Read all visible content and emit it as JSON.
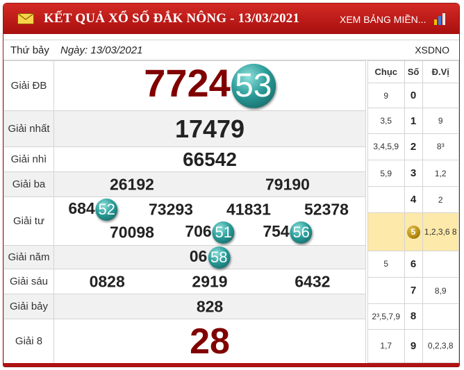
{
  "header": {
    "title": "KẾT QUẢ XỔ SỐ ĐẮK NÔNG - 13/03/2021",
    "link": "XEM BẢNG MIỀN...",
    "icons": {
      "left": "mail-icon",
      "right": "bar-chart-icon"
    },
    "colors": {
      "bar": "#b81a1a",
      "number_dark_red": "#800000",
      "ball": "#2a9c98",
      "highlight": "#fde9a9"
    }
  },
  "subbar": {
    "weekday": "Thứ bảy",
    "date": "Ngày: 13/03/2021",
    "code": "XSDNO"
  },
  "prizes": [
    {
      "label": "Giải ĐB",
      "numbers": [
        {
          "plain": "7724",
          "ball": "53"
        }
      ]
    },
    {
      "label": "Giải nhất",
      "numbers": [
        {
          "plain": "17479",
          "ball": ""
        }
      ]
    },
    {
      "label": "Giải nhì",
      "numbers": [
        {
          "plain": "66542",
          "ball": ""
        }
      ]
    },
    {
      "label": "Giải ba",
      "numbers": [
        {
          "plain": "26192",
          "ball": ""
        },
        {
          "plain": "79190",
          "ball": ""
        }
      ]
    },
    {
      "label": "Giải tư",
      "numbers": [
        {
          "plain": "684",
          "ball": "52"
        },
        {
          "plain": "73293",
          "ball": ""
        },
        {
          "plain": "41831",
          "ball": ""
        },
        {
          "plain": "52378",
          "ball": ""
        },
        {
          "plain": "70098",
          "ball": ""
        },
        {
          "plain": "706",
          "ball": "51"
        },
        {
          "plain": "754",
          "ball": "56"
        }
      ]
    },
    {
      "label": "Giải năm",
      "numbers": [
        {
          "plain": "06",
          "ball": "58"
        }
      ]
    },
    {
      "label": "Giải sáu",
      "numbers": [
        {
          "plain": "0828",
          "ball": ""
        },
        {
          "plain": "2919",
          "ball": ""
        },
        {
          "plain": "6432",
          "ball": ""
        }
      ]
    },
    {
      "label": "Giải bảy",
      "numbers": [
        {
          "plain": "828",
          "ball": ""
        }
      ]
    },
    {
      "label": "Giải 8",
      "numbers": [
        {
          "plain": "28",
          "ball": ""
        }
      ]
    }
  ],
  "loto": {
    "headers": [
      "Chục",
      "Số",
      "Đ.Vị"
    ],
    "rows": [
      {
        "chuc": "9",
        "so": "0",
        "dv": ""
      },
      {
        "chuc": "3,5",
        "so": "1",
        "dv": "9"
      },
      {
        "chuc": "3,4,5,9",
        "so": "2",
        "dv": "8³"
      },
      {
        "chuc": "5,9",
        "so": "3",
        "dv": "1,2"
      },
      {
        "chuc": "",
        "so": "4",
        "dv": "2"
      },
      {
        "chuc": "",
        "so": "5",
        "dv": "1,2,3,6 8"
      },
      {
        "chuc": "5",
        "so": "6",
        "dv": ""
      },
      {
        "chuc": "",
        "so": "7",
        "dv": "8,9"
      },
      {
        "chuc": "2³,5,7,9",
        "so": "8",
        "dv": ""
      },
      {
        "chuc": "1,7",
        "so": "9",
        "dv": "0,2,3,8"
      }
    ]
  }
}
